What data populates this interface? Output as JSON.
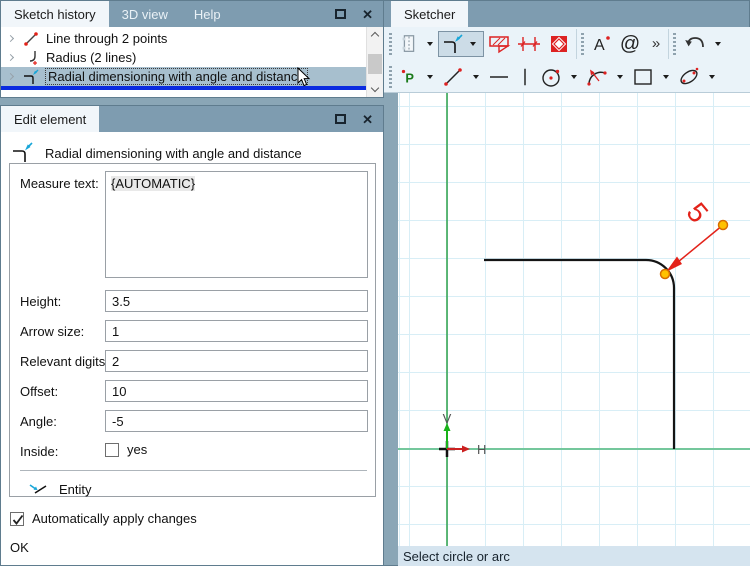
{
  "history_panel": {
    "tabs": [
      "Sketch history",
      "3D view",
      "Help"
    ],
    "items": [
      {
        "icon": "line-2-points-icon",
        "label": "Line through 2 points"
      },
      {
        "icon": "radius-icon",
        "label": "Radius (2 lines)"
      },
      {
        "icon": "radial-dimension-icon",
        "label": "Radial dimensioning with angle and distance",
        "selected": true
      }
    ]
  },
  "edit_panel": {
    "title": "Edit element",
    "header": "Radial dimensioning with angle and distance",
    "measure": {
      "label": "Measure text:",
      "value": "{AUTOMATIC}"
    },
    "rows": [
      {
        "label": "Height:",
        "value": "3.5"
      },
      {
        "label": "Arrow size:",
        "value": "1"
      },
      {
        "label": "Relevant digits:",
        "value": "2"
      },
      {
        "label": "Offset:",
        "value": "10"
      },
      {
        "label": "Angle:",
        "value": "-5"
      }
    ],
    "inside": {
      "label": "Inside:",
      "option": "yes",
      "checked": false
    },
    "entity_label": "Entity",
    "auto_apply": {
      "label": "Automatically apply changes",
      "checked": true
    },
    "ok_label": "OK"
  },
  "sketcher": {
    "tab": "Sketcher",
    "toolbar_row1_icons": [
      "sheet-icon",
      "radial-dimension-icon",
      "hatch-icon",
      "dimension-chain-icon",
      "frame-icon",
      "text-icon",
      "at-icon",
      "overflow-icon",
      "undo-icon"
    ],
    "toolbar_row2_icons": [
      "point-icon",
      "line-icon",
      "horizontal-line-icon",
      "vertical-line-icon",
      "circle-icon",
      "arc-icon",
      "rectangle-icon",
      "ellipse-icon"
    ],
    "selected_tool": "radial-dimension-icon",
    "dimension_label": "5",
    "axis_labels": {
      "vertical": "V",
      "horizontal": "H"
    },
    "status": "Select circle or arc"
  },
  "colors": {
    "titlebar": "#7e9cb0",
    "active_tab": "#f1f6fa",
    "tree_selection": "#a7bfce",
    "insert_line": "#0a2be0",
    "toolbar_bg": "#eaf3f9",
    "grid": "#d8eef6",
    "axis_vertical_green": "#2ca04a",
    "axis_horizontal_green": "#74c79c",
    "dimension_red": "#e32219",
    "handle_orange": "#ffc200",
    "status_bg": "#d5e4ef"
  }
}
